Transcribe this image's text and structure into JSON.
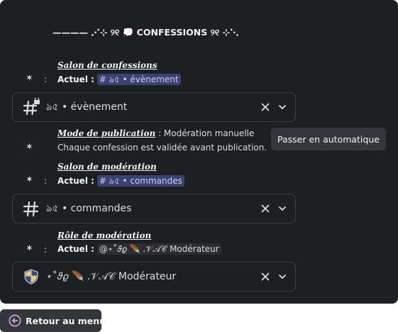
{
  "header": {
    "title": "———— ⋰⊹ ୨୧ 💭 CONFESSIONS ୨୧ ⊹⋱"
  },
  "bullet_glyph": "✶",
  "colon": ":",
  "sections": {
    "confession_channel": {
      "title": "Salon de confessions",
      "current_label": "Actuel :",
      "current_value": "# ঌ৫ • évènement",
      "select_value": "ঌ৫ • évènement",
      "select_icon": "hash-lock-icon"
    },
    "publication_mode": {
      "title": "Mode de publication",
      "mode_value": ": Modération manuelle",
      "description": "Chaque confession est validée avant publication.",
      "toggle_button": "Passer en automatique"
    },
    "moderation_channel": {
      "title": "Salon de modération",
      "current_label": "Actuel :",
      "current_value": "# ঌ৫ • commandes",
      "select_value": "ঌ৫ • commandes",
      "select_icon": "hash-icon"
    },
    "moderation_role": {
      "title": "Rôle de modération",
      "current_label": "Actuel :",
      "current_value": "@⋆˚𝜗𝜚 🪶 .𝒱𝒜𝒞 Modérateur",
      "select_value": "⋆˚𝜗𝜚 🪶 .𝒱𝒜𝒞 Modérateur",
      "select_icon": "shield-icon"
    }
  },
  "footer": {
    "back_button": "Retour au menu"
  },
  "colors": {
    "panel_bg": "#1e1f22",
    "mention_bg": "#3c4270",
    "mention_text": "#c9cdfb",
    "button_bg": "#35363c",
    "select_border": "#3f4147",
    "back_icon_bg": "#c9a3d8"
  }
}
